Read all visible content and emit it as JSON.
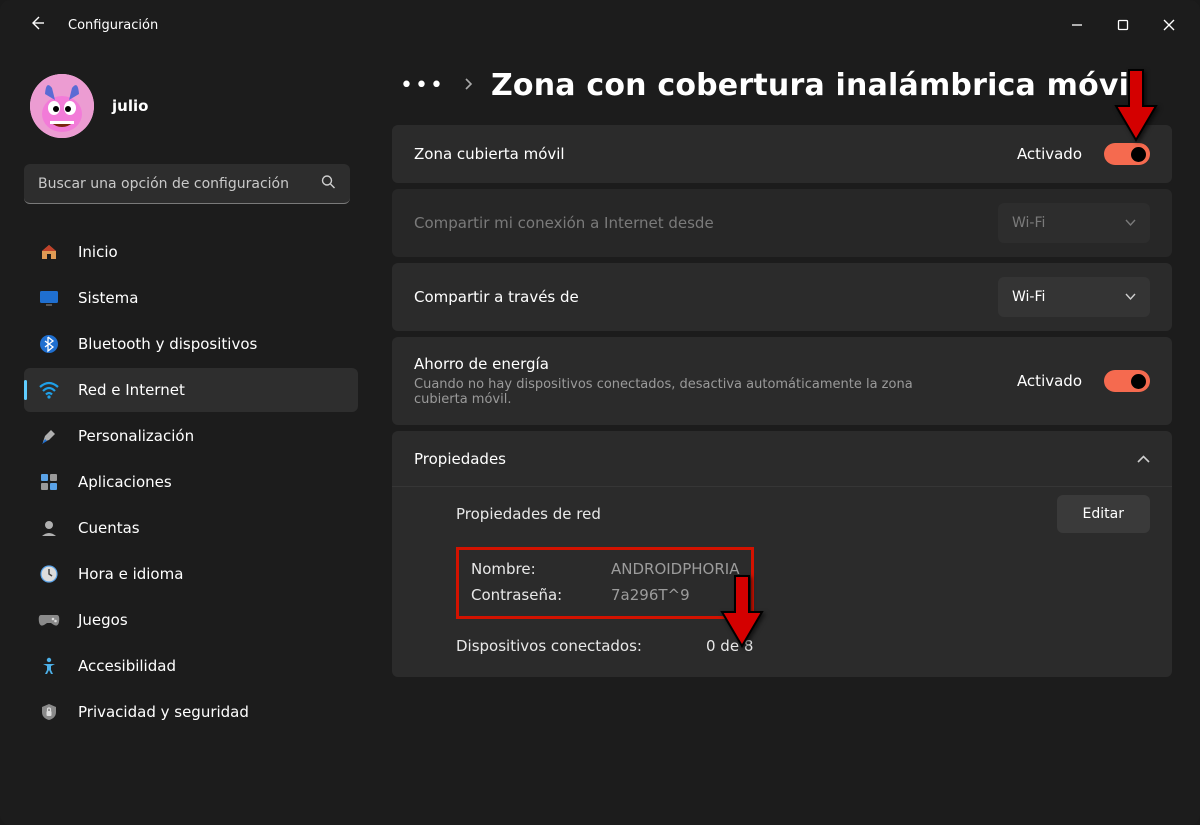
{
  "app": {
    "title": "Configuración"
  },
  "user": {
    "name": "julio"
  },
  "search": {
    "placeholder": "Buscar una opción de configuración"
  },
  "nav": {
    "home": {
      "label": "Inicio"
    },
    "system": {
      "label": "Sistema"
    },
    "bluetooth": {
      "label": "Bluetooth y dispositivos"
    },
    "network": {
      "label": "Red e Internet"
    },
    "personal": {
      "label": "Personalización"
    },
    "apps": {
      "label": "Aplicaciones"
    },
    "accounts": {
      "label": "Cuentas"
    },
    "time": {
      "label": "Hora e idioma"
    },
    "games": {
      "label": "Juegos"
    },
    "access": {
      "label": "Accesibilidad"
    },
    "privacy": {
      "label": "Privacidad y seguridad"
    }
  },
  "breadcrumb": {
    "title": "Zona con cobertura inalámbrica móvil"
  },
  "hotspot_toggle": {
    "label": "Zona cubierta móvil",
    "state": "Activado"
  },
  "share_from": {
    "label": "Compartir mi conexión a Internet desde",
    "value": "Wi-Fi"
  },
  "share_via": {
    "label": "Compartir a través de",
    "value": "Wi-Fi"
  },
  "powersave": {
    "label": "Ahorro de energía",
    "sub": "Cuando no hay dispositivos conectados, desactiva automáticamente la zona cubierta móvil.",
    "state": "Activado"
  },
  "properties": {
    "header": "Propiedades",
    "section": "Propiedades de red",
    "edit": "Editar",
    "name_k": "Nombre:",
    "name_v": "ANDROIDPHORIA",
    "pass_k": "Contraseña:",
    "pass_v": "7a296T^9",
    "devices_k": "Dispositivos conectados:",
    "devices_v": "0 de 8"
  }
}
